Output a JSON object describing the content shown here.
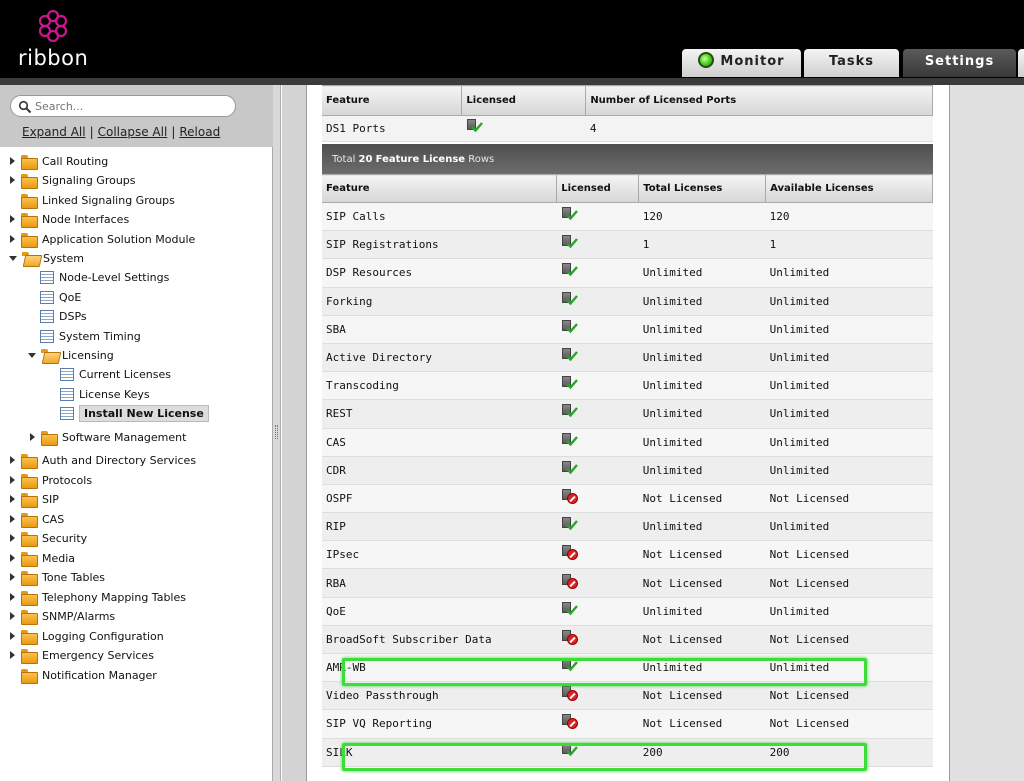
{
  "app": {
    "logo_text": "ribbon"
  },
  "tabs": [
    {
      "label": "Monitor",
      "active": false
    },
    {
      "label": "Tasks",
      "active": false
    },
    {
      "label": "Settings",
      "active": true
    }
  ],
  "sidebar": {
    "search_placeholder": "Search...",
    "links": {
      "expand_all": "Expand All",
      "collapse_all": "Collapse All",
      "reload": "Reload"
    },
    "tree": [
      {
        "label": "Call Routing"
      },
      {
        "label": "Signaling Groups"
      },
      {
        "label": "Linked Signaling Groups"
      },
      {
        "label": "Node Interfaces"
      },
      {
        "label": "Application Solution Module"
      },
      {
        "label": "System"
      },
      {
        "label": "Node-Level Settings"
      },
      {
        "label": "QoE"
      },
      {
        "label": "DSPs"
      },
      {
        "label": "System Timing"
      },
      {
        "label": "Licensing"
      },
      {
        "label": "Current Licenses"
      },
      {
        "label": "License Keys"
      },
      {
        "label": "Install New License",
        "selected": true
      },
      {
        "label": "Software Management"
      },
      {
        "label": "Auth and Directory Services"
      },
      {
        "label": "Protocols"
      },
      {
        "label": "SIP"
      },
      {
        "label": "CAS"
      },
      {
        "label": "Security"
      },
      {
        "label": "Media"
      },
      {
        "label": "Tone Tables"
      },
      {
        "label": "Telephony Mapping Tables"
      },
      {
        "label": "SNMP/Alarms"
      },
      {
        "label": "Logging Configuration"
      },
      {
        "label": "Emergency Services"
      },
      {
        "label": "Notification Manager"
      }
    ]
  },
  "ports_table": {
    "headers": [
      "Feature",
      "Licensed",
      "Number of Licensed Ports"
    ],
    "rows": [
      {
        "feature": "DS1 Ports",
        "licensed": true,
        "ports": "4"
      }
    ]
  },
  "total_bar": {
    "prefix": "Total",
    "count": "20",
    "middle": "Feature License",
    "suffix": "Rows"
  },
  "feature_table": {
    "headers": [
      "Feature",
      "Licensed",
      "Total Licenses",
      "Available Licenses"
    ],
    "rows": [
      {
        "feature": "SIP Calls",
        "licensed": true,
        "total": "120",
        "available": "120"
      },
      {
        "feature": "SIP Registrations",
        "licensed": true,
        "total": "1",
        "available": "1"
      },
      {
        "feature": "DSP Resources",
        "licensed": true,
        "total": "Unlimited",
        "available": "Unlimited"
      },
      {
        "feature": "Forking",
        "licensed": true,
        "total": "Unlimited",
        "available": "Unlimited"
      },
      {
        "feature": "SBA",
        "licensed": true,
        "total": "Unlimited",
        "available": "Unlimited"
      },
      {
        "feature": "Active Directory",
        "licensed": true,
        "total": "Unlimited",
        "available": "Unlimited"
      },
      {
        "feature": "Transcoding",
        "licensed": true,
        "total": "Unlimited",
        "available": "Unlimited"
      },
      {
        "feature": "REST",
        "licensed": true,
        "total": "Unlimited",
        "available": "Unlimited"
      },
      {
        "feature": "CAS",
        "licensed": true,
        "total": "Unlimited",
        "available": "Unlimited"
      },
      {
        "feature": "CDR",
        "licensed": true,
        "total": "Unlimited",
        "available": "Unlimited"
      },
      {
        "feature": "OSPF",
        "licensed": false,
        "total": "Not Licensed",
        "available": "Not Licensed"
      },
      {
        "feature": "RIP",
        "licensed": true,
        "total": "Unlimited",
        "available": "Unlimited"
      },
      {
        "feature": "IPsec",
        "licensed": false,
        "total": "Not Licensed",
        "available": "Not Licensed"
      },
      {
        "feature": "RBA",
        "licensed": false,
        "total": "Not Licensed",
        "available": "Not Licensed"
      },
      {
        "feature": "QoE",
        "licensed": true,
        "total": "Unlimited",
        "available": "Unlimited"
      },
      {
        "feature": "BroadSoft Subscriber Data",
        "licensed": false,
        "total": "Not Licensed",
        "available": "Not Licensed"
      },
      {
        "feature": "AMR-WB",
        "licensed": true,
        "total": "Unlimited",
        "available": "Unlimited",
        "highlighted": true
      },
      {
        "feature": "Video Passthrough",
        "licensed": false,
        "total": "Not Licensed",
        "available": "Not Licensed"
      },
      {
        "feature": "SIP VQ Reporting",
        "licensed": false,
        "total": "Not Licensed",
        "available": "Not Licensed"
      },
      {
        "feature": "SILK",
        "licensed": true,
        "total": "200",
        "available": "200",
        "highlighted": true
      }
    ]
  },
  "colors": {
    "highlight": "#3ddc38",
    "brand": "#c8168c"
  }
}
